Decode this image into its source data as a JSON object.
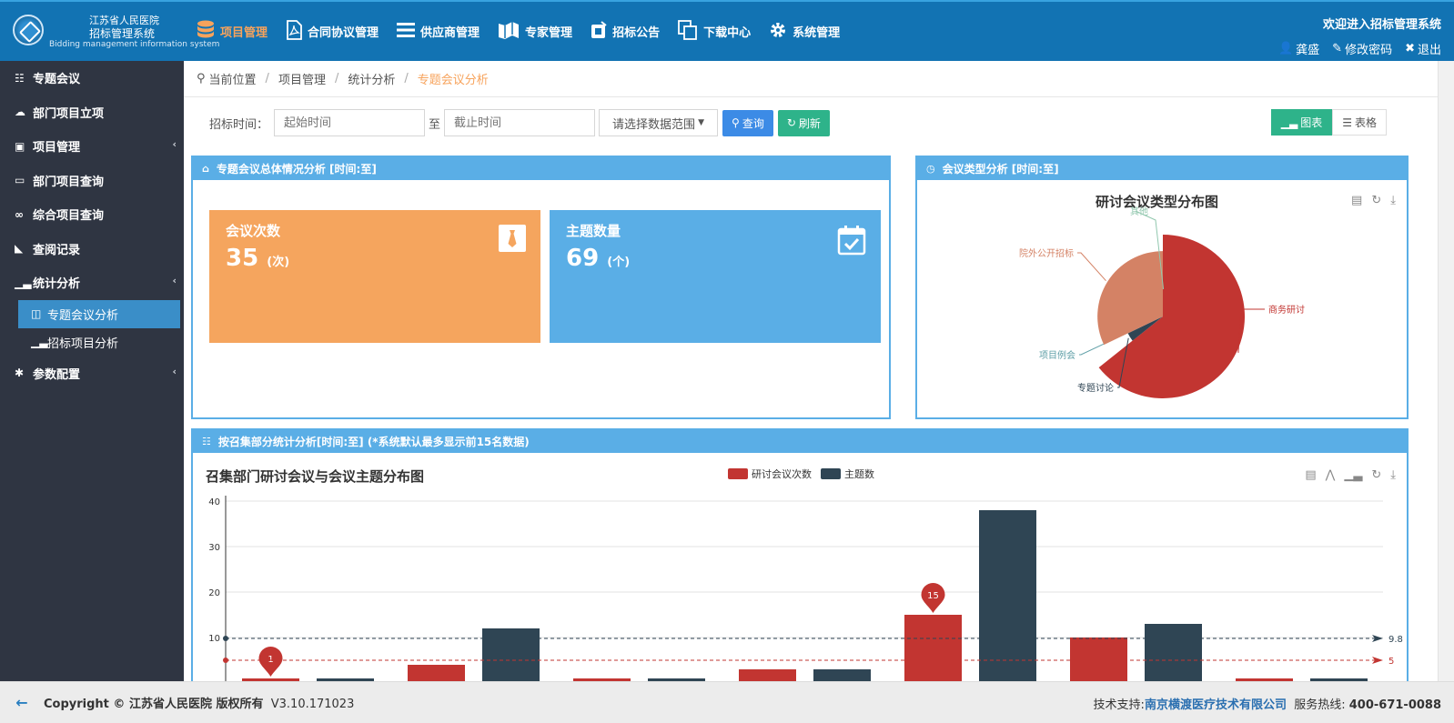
{
  "header": {
    "logo_line1": "江苏省人民医院",
    "logo_line2": "招标管理系统",
    "logo_line3": "Bidding management information system",
    "nav": [
      {
        "label": "项目管理",
        "icon": "database-icon"
      },
      {
        "label": "合同协议管理",
        "icon": "pdf-icon"
      },
      {
        "label": "供应商管理",
        "icon": "list-icon"
      },
      {
        "label": "专家管理",
        "icon": "map-icon"
      },
      {
        "label": "招标公告",
        "icon": "notice-icon"
      },
      {
        "label": "下载中心",
        "icon": "copy-icon"
      },
      {
        "label": "系统管理",
        "icon": "gear-icon"
      }
    ],
    "welcome": "欢迎进入招标管理系统",
    "user": "龚盛",
    "change_password": "修改密码",
    "logout": "退出",
    "accent": "#f7a35c"
  },
  "sidebar": {
    "items": [
      {
        "label": "专题会议"
      },
      {
        "label": "部门项目立项"
      },
      {
        "label": "项目管理"
      },
      {
        "label": "部门项目查询"
      },
      {
        "label": "综合项目查询"
      },
      {
        "label": "查阅记录"
      },
      {
        "label": "统计分析"
      },
      {
        "label": "专题会议分析"
      },
      {
        "label": "招标项目分析"
      },
      {
        "label": "参数配置"
      }
    ]
  },
  "breadcrumb": {
    "root": "当前位置",
    "items": [
      "项目管理",
      "统计分析"
    ],
    "current": "专题会议分析"
  },
  "filters": {
    "label": "招标时间：",
    "start_placeholder": "起始时间",
    "to": "至",
    "end_placeholder": "截止时间",
    "range_select": "请选择数据范围",
    "query_button": "查询",
    "refresh_button": "刷新",
    "view_chart": "图表",
    "view_table": "表格"
  },
  "panels": {
    "overview_title": "专题会议总体情况分析 [时间:至]",
    "type_title": "会议类型分析 [时间:至]",
    "dept_title": "按召集部分统计分析[时间:至] (*系统默认最多显示前15名数据)"
  },
  "stats": {
    "meetings_label": "会议次数",
    "meetings_value": "35",
    "meetings_unit": "(次)",
    "topics_label": "主题数量",
    "topics_value": "69",
    "topics_unit": "(个)"
  },
  "pie": {
    "title": "研讨会议类型分布图",
    "colors": [
      "#c23531",
      "#2f4554",
      "#61a0a8",
      "#d48265",
      "#91c7ae"
    ],
    "chart_data": {
      "type": "pie",
      "categories": [
        "商务研讨",
        "专题讨论",
        "项目例会",
        "院外公开招标",
        "其他"
      ],
      "values": [
        18,
        1,
        0,
        9,
        0
      ]
    }
  },
  "bar": {
    "title": "召集部门研讨会议与会议主题分布图",
    "colors": [
      "#c23531",
      "#2f4554"
    ],
    "chart_data": {
      "type": "bar",
      "categories": [
        "",
        "",
        "",
        "",
        "",
        "",
        "",
        ""
      ],
      "series": [
        {
          "name": "研讨会议次数",
          "values": [
            1,
            4,
            1,
            3,
            15,
            10,
            1,
            0
          ]
        },
        {
          "name": "主题数",
          "values": [
            1,
            12,
            1,
            3,
            38,
            13,
            1,
            0
          ]
        }
      ],
      "ylim": [
        0,
        40
      ],
      "yticks": [
        40,
        30,
        20,
        10
      ],
      "mark_points": [
        "1",
        "15"
      ],
      "mark_lines": [
        {
          "series": "主题数",
          "value": "9.8"
        },
        {
          "series": "研讨会议次数",
          "value": "5"
        }
      ]
    }
  },
  "footer": {
    "copyright": "Copyright © 江苏省人民医院 版权所有",
    "version": "V3.10.171023",
    "support_label": "技术支持:",
    "support_company": "南京横渡医疗技术有限公司",
    "hotline_label": "服务热线:",
    "hotline": "400-671-0088"
  }
}
